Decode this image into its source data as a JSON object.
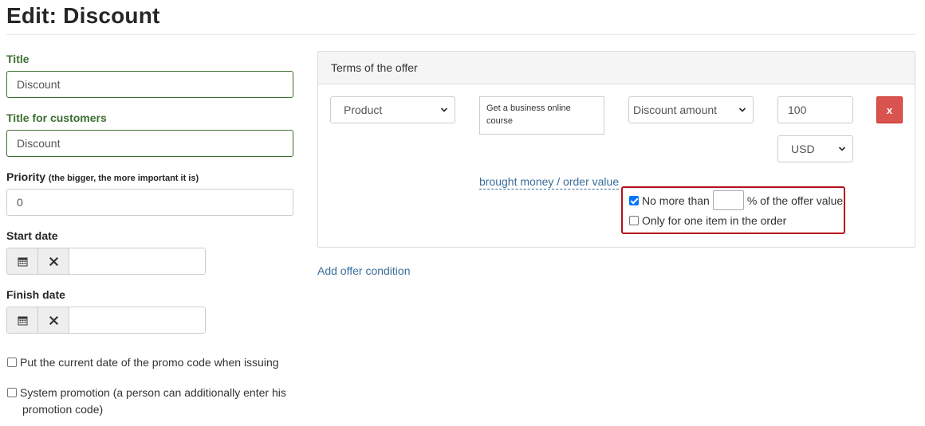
{
  "page": {
    "title": "Edit: Discount"
  },
  "form": {
    "title_label": "Title",
    "title_value": "Discount",
    "customer_title_label": "Title for customers",
    "customer_title_value": "Discount",
    "priority_label": "Priority",
    "priority_hint": "(the bigger, the more important it is)",
    "priority_value": "0",
    "start_date_label": "Start date",
    "finish_date_label": "Finish date",
    "current_date_label": "Put the current date of the promo code when issuing",
    "current_date_checked": false,
    "system_promo_label": "System promotion (a person can additionally enter his",
    "system_promo_label2": "promotion code)",
    "system_promo_checked": false
  },
  "offer": {
    "panel_title": "Terms of the offer",
    "type_select": "Product",
    "product_text": "Get a business online course",
    "discount_select": "Discount amount",
    "amount_value": "100",
    "currency_select": "USD",
    "delete_label": "x",
    "calc_link": "brought money / order value",
    "no_more_than_label": "No more than",
    "no_more_than_checked": true,
    "percent_suffix": "% of the offer value",
    "one_item_label": "Only for one item in the order",
    "one_item_checked": false,
    "add_condition_link": "Add offer condition"
  },
  "colors": {
    "label_green": "#3c6e2f",
    "link_blue": "#3a6d9a",
    "danger_red": "#d9534f",
    "highlight_red": "#b5121b"
  },
  "icons": {
    "calendar": "calendar-icon",
    "clear": "close-icon",
    "dropdown": "chevron-down-icon"
  }
}
